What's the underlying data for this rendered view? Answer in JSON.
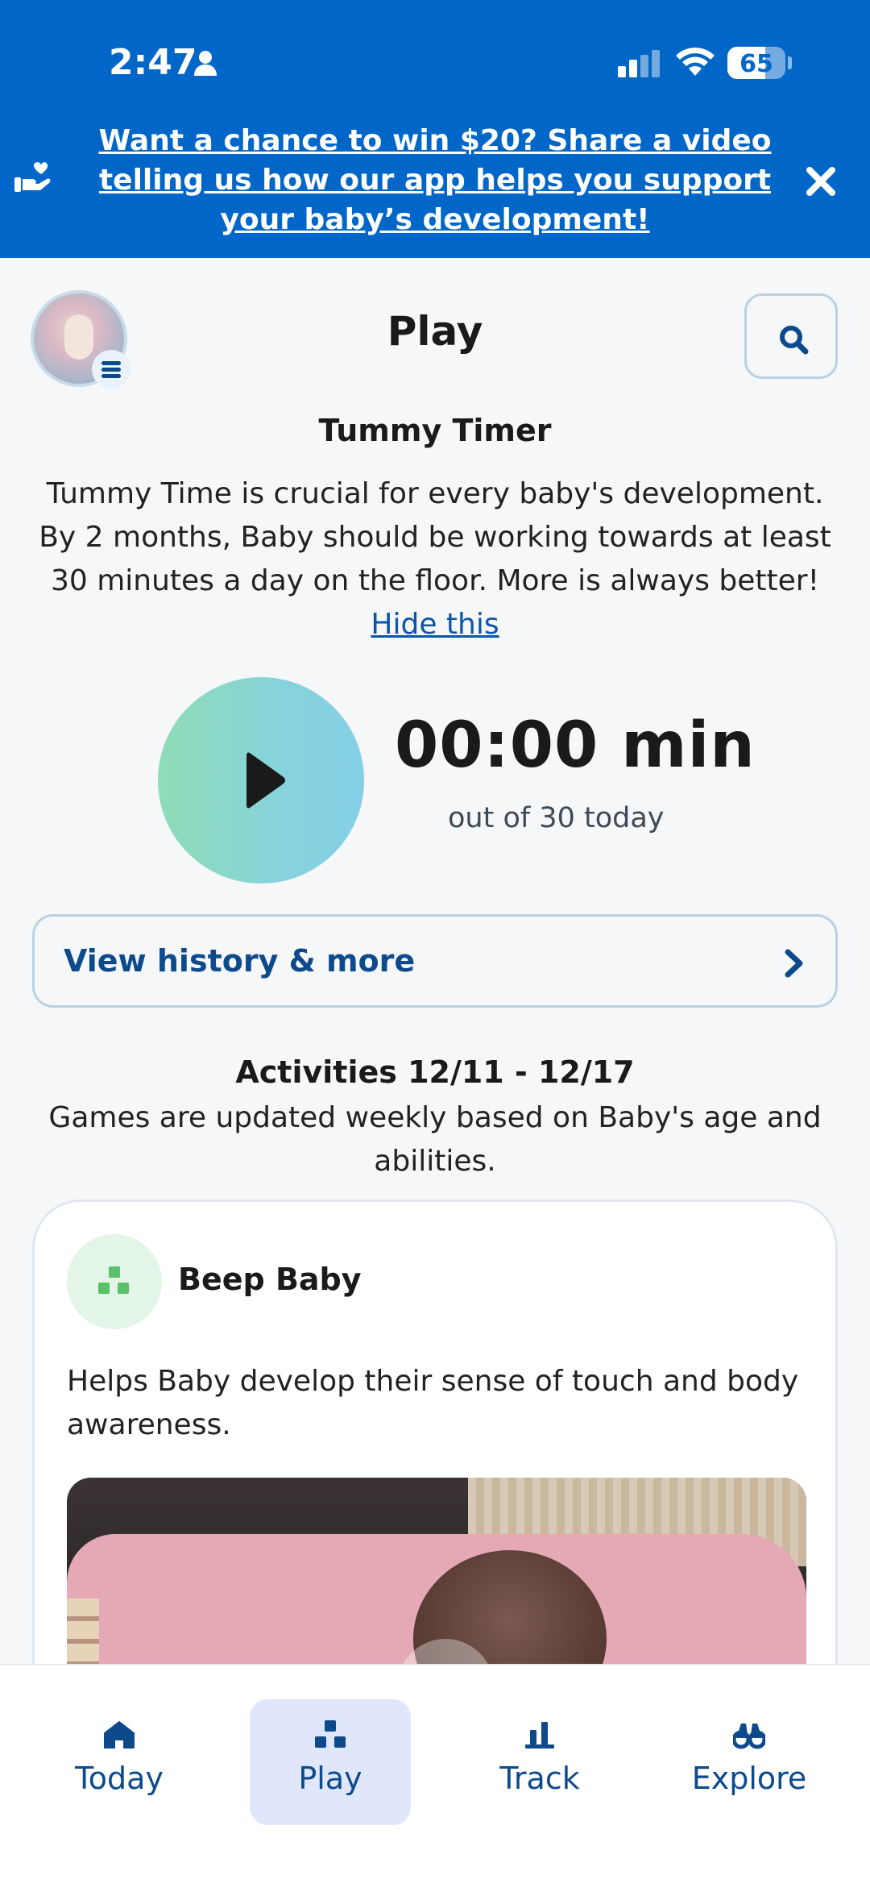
{
  "status_bar": {
    "time": "2:47",
    "battery": "65"
  },
  "banner": {
    "promo_text": "Want a chance to win $20? Share a video telling us how our app helps you support your baby’s development!",
    "bg_color": "#0066c7"
  },
  "header": {
    "title": "Play"
  },
  "tummy_timer": {
    "title": "Tummy Timer",
    "description": "Tummy Time is crucial for every baby's development. By 2 months, Baby should be working towards at least 30 minutes a day on the floor. More is always better!",
    "hide_link": "Hide this",
    "time": "00:00",
    "unit": "min",
    "goal_text": "out of 30 today",
    "history_button": "View history & more"
  },
  "activities": {
    "title": "Activities 12/11 - 12/17",
    "subtitle": "Games are updated weekly based on Baby's age and abilities.",
    "card": {
      "title": "Beep Baby",
      "description": "Helps Baby develop their sense of touch and body awareness."
    }
  },
  "bottom_nav": {
    "items": [
      {
        "label": "Today",
        "icon": "home-icon"
      },
      {
        "label": "Play",
        "icon": "blocks-icon",
        "active": true
      },
      {
        "label": "Track",
        "icon": "bar-chart-icon"
      },
      {
        "label": "Explore",
        "icon": "binoculars-icon"
      }
    ],
    "accent": "#0d4a8c"
  }
}
